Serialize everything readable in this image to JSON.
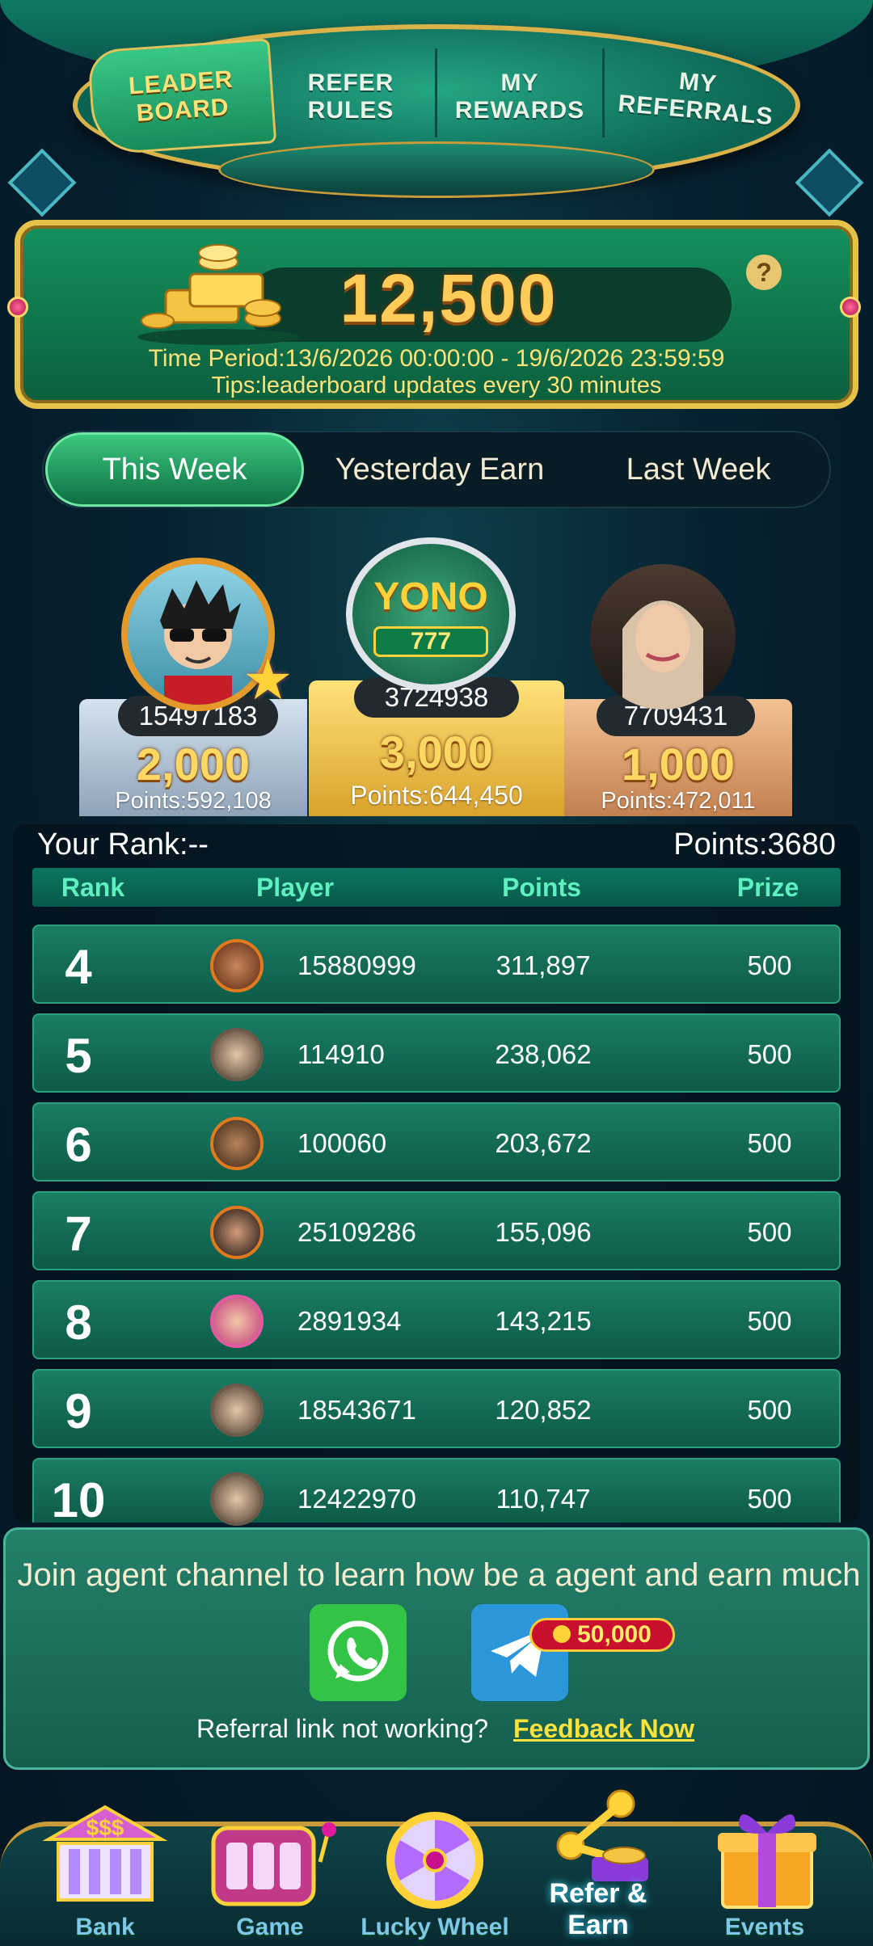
{
  "tabs": [
    {
      "label": "LEADER\nBOARD",
      "active": true
    },
    {
      "label": "REFER\nRULES",
      "active": false
    },
    {
      "label": "MY\nREWARDS",
      "active": false
    },
    {
      "label": "MY\nREFERRALS",
      "active": false
    }
  ],
  "prize": {
    "amount": "12,500",
    "help": "?",
    "period": "Time Period:13/6/2026 00:00:00 - 19/6/2026 23:59:59",
    "tips": "Tips:leaderboard updates every 30 minutes"
  },
  "period_tabs": [
    {
      "label": "This Week",
      "active": true
    },
    {
      "label": "Yesterday Earn",
      "active": false
    },
    {
      "label": "Last Week",
      "active": false
    }
  ],
  "podium": {
    "second": {
      "id": "15497183",
      "prize": "2,000",
      "points": "Points:592,108"
    },
    "first": {
      "id": "3724938",
      "prize": "3,000",
      "points": "Points:644,450",
      "logo": "YONO"
    },
    "third": {
      "id": "7709431",
      "prize": "1,000",
      "points": "Points:472,011"
    }
  },
  "my_rank": {
    "rank": "Your Rank:--",
    "points": "Points:3680"
  },
  "table": {
    "headers": [
      "Rank",
      "Player",
      "Points",
      "Prize"
    ],
    "rows": [
      {
        "rank": "4",
        "player": "15880999",
        "points": "311,897",
        "prize": "500"
      },
      {
        "rank": "5",
        "player": "114910",
        "points": "238,062",
        "prize": "500"
      },
      {
        "rank": "6",
        "player": "100060",
        "points": "203,672",
        "prize": "500"
      },
      {
        "rank": "7",
        "player": "25109286",
        "points": "155,096",
        "prize": "500"
      },
      {
        "rank": "8",
        "player": "2891934",
        "points": "143,215",
        "prize": "500"
      },
      {
        "rank": "9",
        "player": "18543671",
        "points": "120,852",
        "prize": "500"
      },
      {
        "rank": "10",
        "player": "12422970",
        "points": "110,747",
        "prize": "500"
      }
    ]
  },
  "agent": {
    "text": "Join agent channel to learn how be a agent and earn much",
    "referral_issue": "Referral link not working?",
    "feedback": "Feedback Now"
  },
  "nav": {
    "items": [
      {
        "label": "Bank",
        "icon": "bank-icon"
      },
      {
        "label": "Game",
        "icon": "slot-machine-icon"
      },
      {
        "label": "Lucky Wheel",
        "icon": "wheel-icon"
      },
      {
        "label": "Refer & Earn",
        "icon": "share-coins-icon",
        "active": true
      },
      {
        "label": "Events",
        "icon": "gift-icon"
      }
    ],
    "badge": "50,000"
  },
  "colors": {
    "accent": "#1b8a63",
    "gold": "#e7c24a",
    "highlight": "#ffe23c"
  }
}
